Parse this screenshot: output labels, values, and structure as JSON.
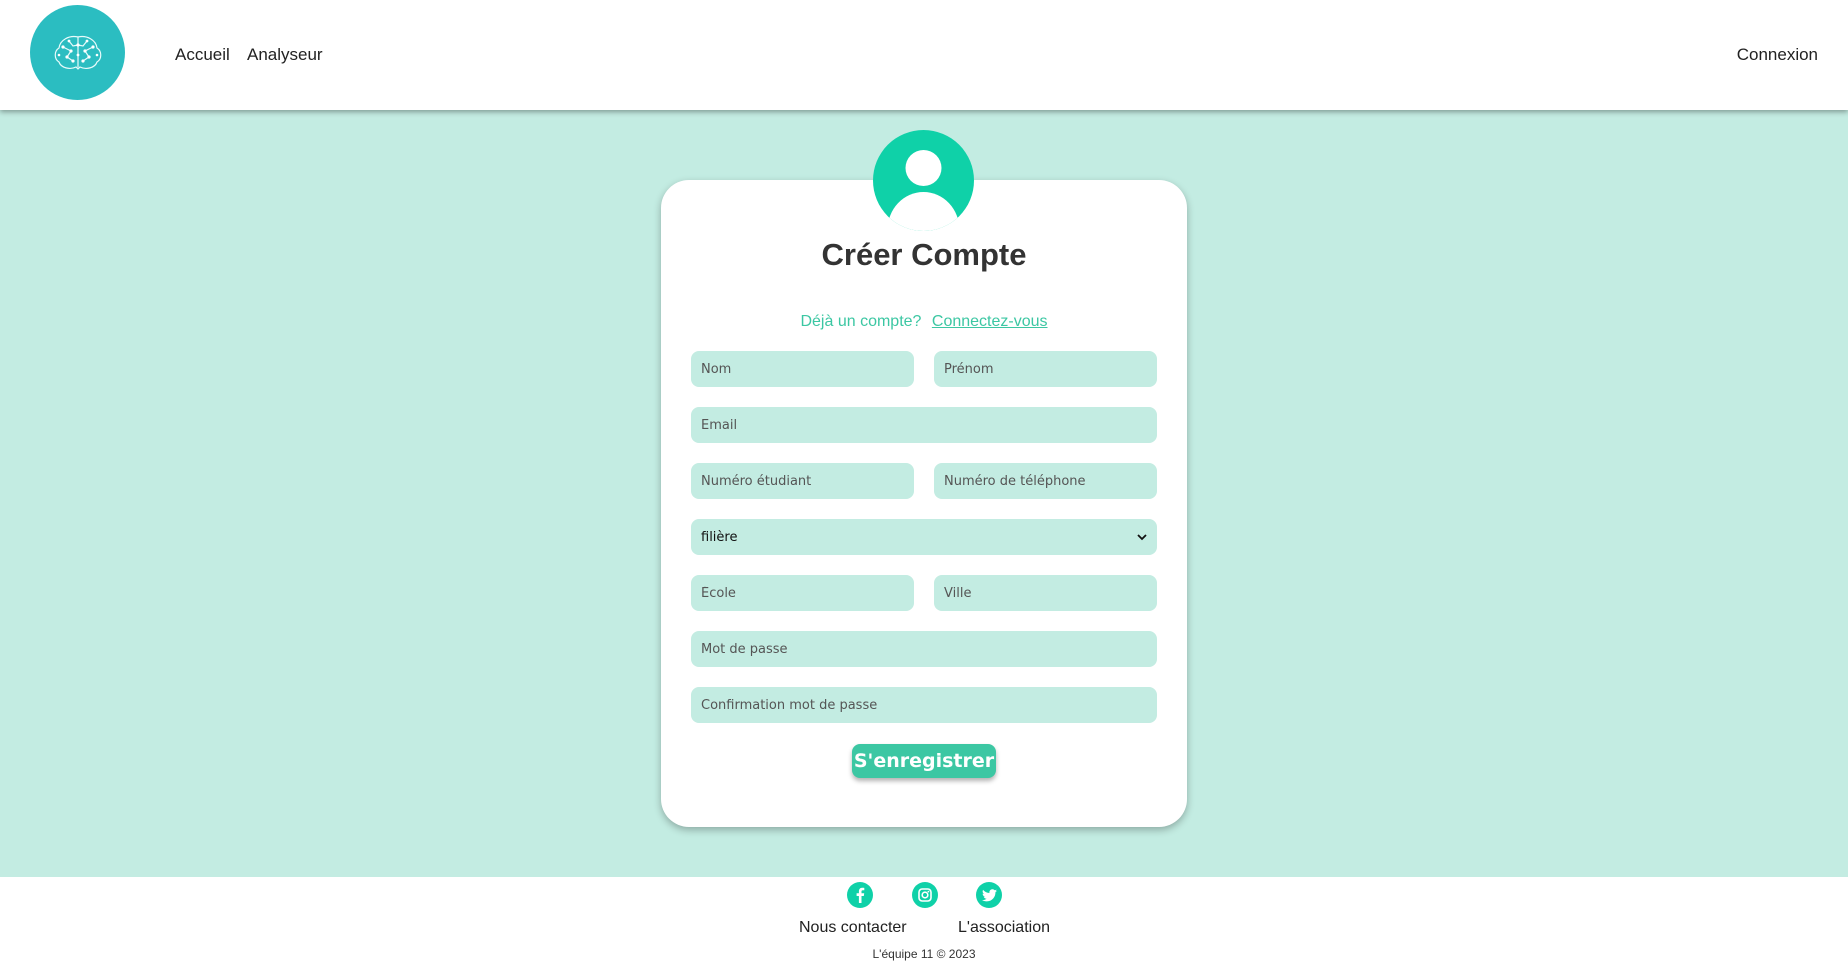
{
  "nav": {
    "home": "Accueil",
    "analyzer": "Analyseur",
    "login": "Connexion"
  },
  "form": {
    "title": "Créer Compte",
    "already_text": "Déjà un compte?",
    "login_link": "Connectez-vous",
    "last_name_placeholder": "Nom",
    "first_name_placeholder": "Prénom",
    "email_placeholder": "Email",
    "student_number_placeholder": "Numéro étudiant",
    "phone_placeholder": "Numéro de téléphone",
    "program_select": "filière",
    "school_placeholder": "École",
    "city_placeholder": "Ville",
    "password_placeholder": "Mot de passe",
    "confirm_password_placeholder": "Confirmation mot de passe",
    "submit_label": "S'enregistrer"
  },
  "footer": {
    "contact": "Nous contacter",
    "association": "L'association",
    "copyright": "L'équipe 11 © 2023"
  },
  "colors": {
    "accent": "#3cc7a3",
    "icon_bg": "#0fd1a8",
    "page_bg": "#c3ece2",
    "logo_bg": "#2bbdc1"
  },
  "icons": {
    "logo": "brain-icon",
    "avatar": "user-icon",
    "social": [
      "facebook-icon",
      "instagram-icon",
      "twitter-icon"
    ]
  }
}
